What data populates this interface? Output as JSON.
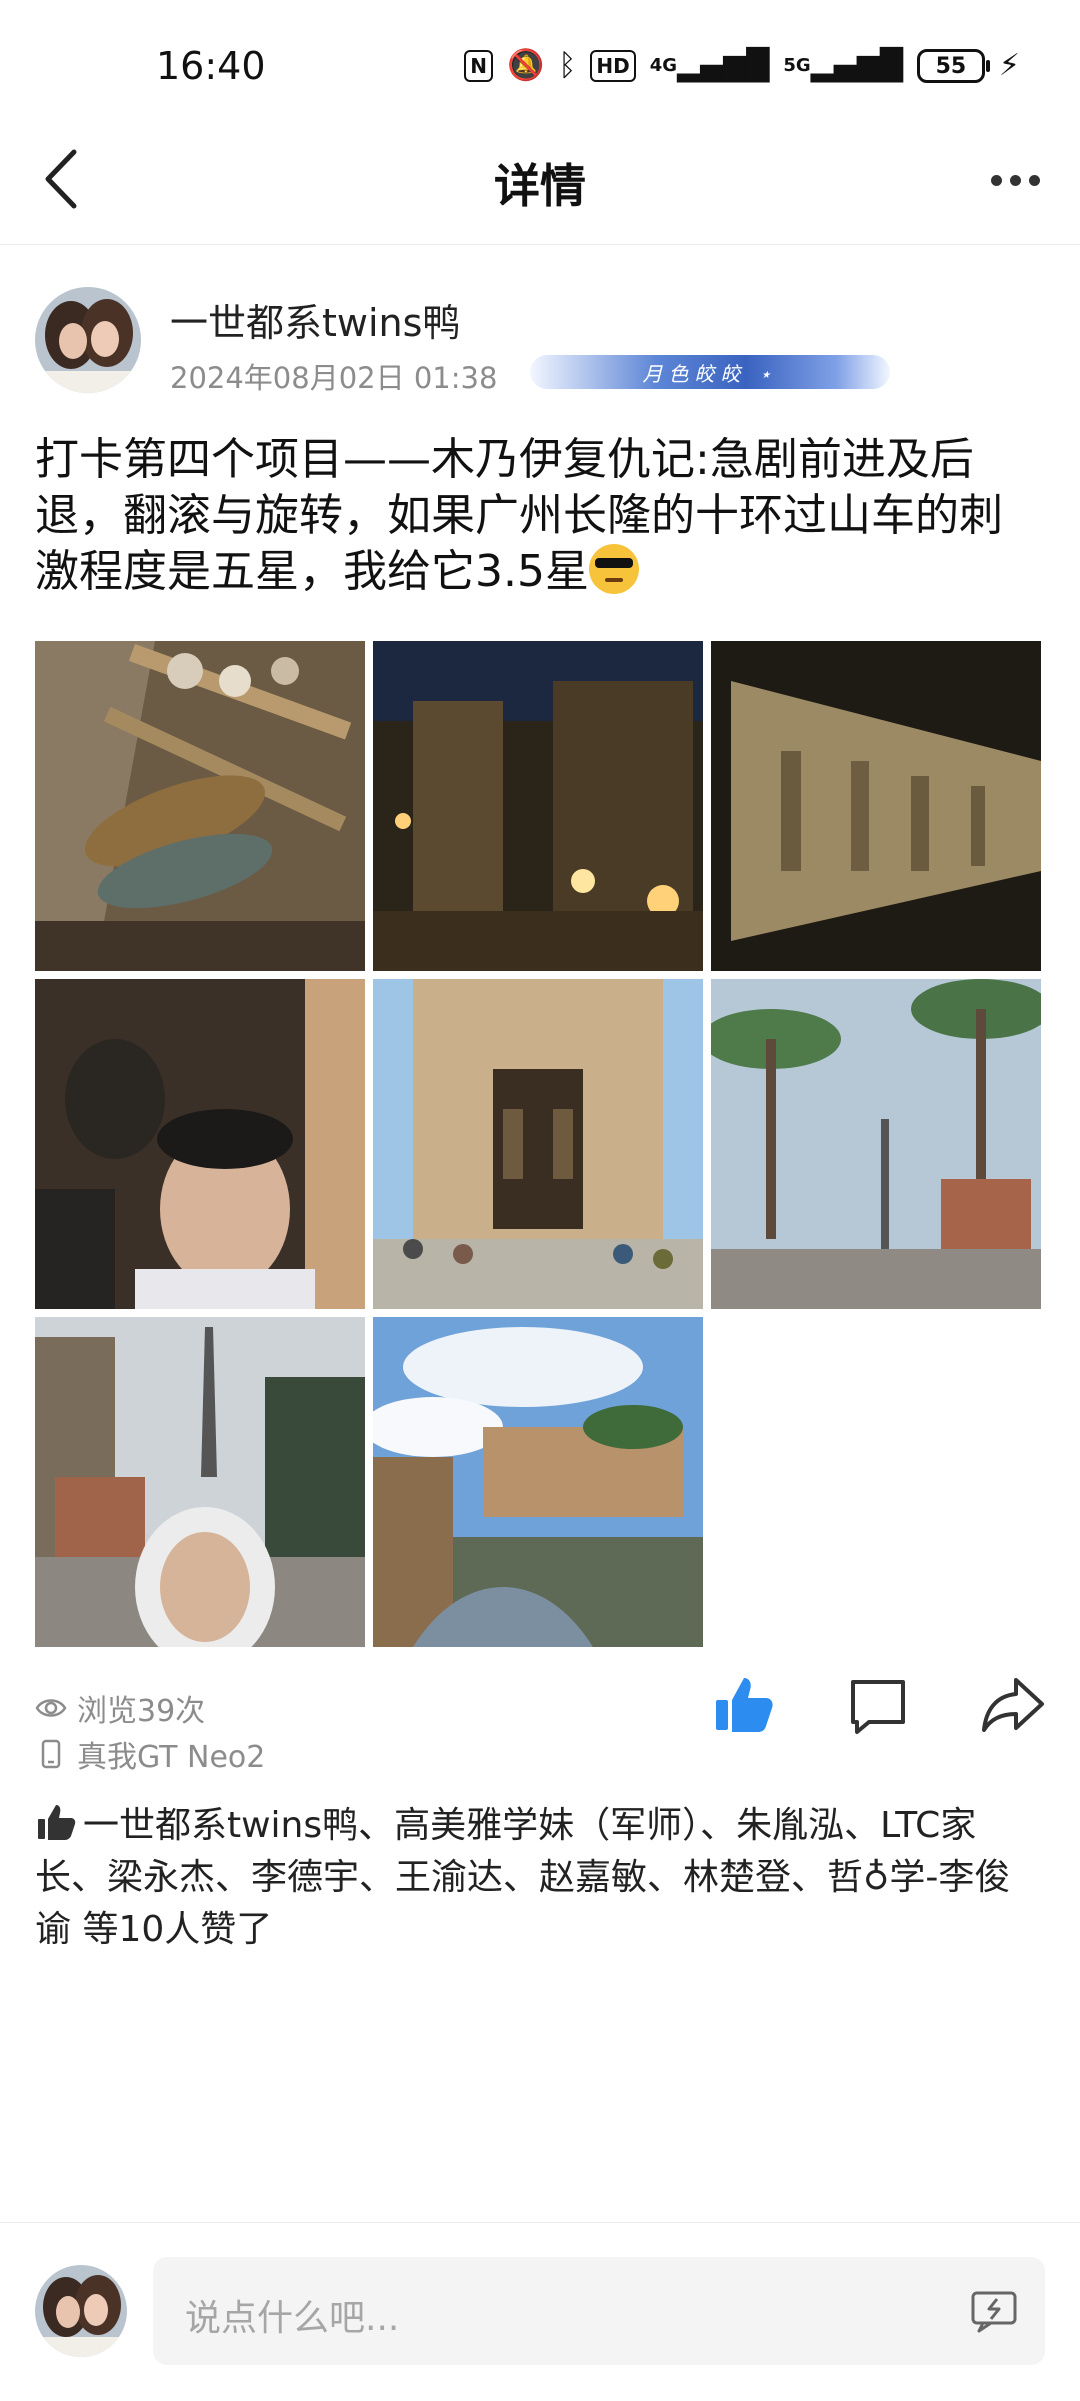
{
  "status_bar": {
    "time": "16:40",
    "network_labels": [
      "HD",
      "4G",
      "5G"
    ],
    "battery": "55"
  },
  "nav": {
    "title": "详情"
  },
  "post": {
    "author": "一世都系twins鸭",
    "timestamp": "2024年08月02日 01:38",
    "badge_text": "月色皎皎 ⋆",
    "text": "打卡第四个项目——木乃伊复仇记:急剧前进及后退，翻滚与旋转，如果广州长隆的十环过山车的刺激程度是五星，我给它3.5星",
    "emoji": "sunglasses-face",
    "photo_count": 8,
    "views": "浏览39次",
    "device": "真我GT Neo2",
    "likes_text": "一世都系twins鸭、高美雅学妹（军师）、朱胤泓、LTC家长、梁永杰、李德宇、王渝达、赵嘉敏、林楚登、哲♁学-李俊谕 等10人赞了"
  },
  "comment_bar": {
    "placeholder": "说点什么吧..."
  },
  "colors": {
    "accent": "#2d8cf0",
    "muted": "#8c8c8c"
  }
}
